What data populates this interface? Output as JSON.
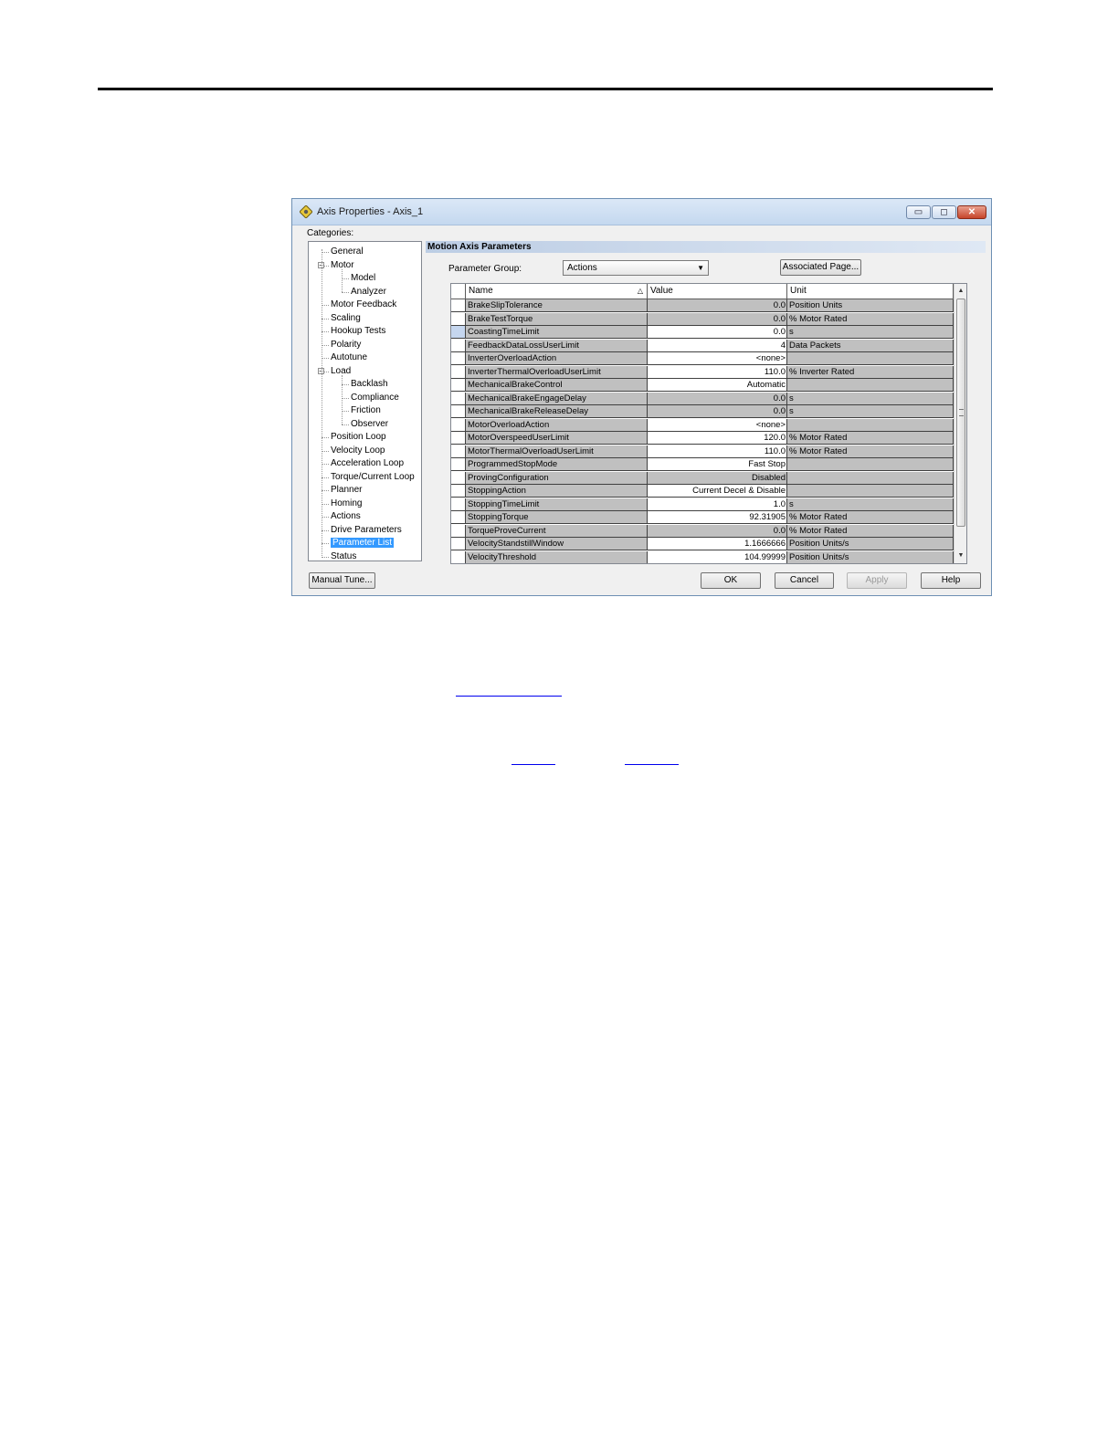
{
  "dialog": {
    "title": "Axis Properties - Axis_1",
    "controls": {
      "minimize": "▭",
      "maximize": "◻",
      "close": "✕"
    },
    "categories_label": "Categories:",
    "categories": [
      {
        "label": "General",
        "level": 1
      },
      {
        "label": "Motor",
        "level": 1,
        "expander": "−"
      },
      {
        "label": "Model",
        "level": 2
      },
      {
        "label": "Analyzer",
        "level": 2
      },
      {
        "label": "Motor Feedback",
        "level": 1
      },
      {
        "label": "Scaling",
        "level": 1
      },
      {
        "label": "Hookup Tests",
        "level": 1
      },
      {
        "label": "Polarity",
        "level": 1
      },
      {
        "label": "Autotune",
        "level": 1
      },
      {
        "label": "Load",
        "level": 1,
        "expander": "−"
      },
      {
        "label": "Backlash",
        "level": 2
      },
      {
        "label": "Compliance",
        "level": 2
      },
      {
        "label": "Friction",
        "level": 2
      },
      {
        "label": "Observer",
        "level": 2
      },
      {
        "label": "Position Loop",
        "level": 1
      },
      {
        "label": "Velocity Loop",
        "level": 1
      },
      {
        "label": "Acceleration Loop",
        "level": 1
      },
      {
        "label": "Torque/Current Loop",
        "level": 1
      },
      {
        "label": "Planner",
        "level": 1
      },
      {
        "label": "Homing",
        "level": 1
      },
      {
        "label": "Actions",
        "level": 1
      },
      {
        "label": "Drive Parameters",
        "level": 1
      },
      {
        "label": "Parameter List",
        "level": 1,
        "selected": true
      },
      {
        "label": "Status",
        "level": 1
      }
    ],
    "section_title": "Motion Axis Parameters",
    "parameter_group": {
      "label": "Parameter Group:",
      "value": "Actions"
    },
    "associated_page_label": "Associated Page...",
    "table": {
      "columns": {
        "name": "Name",
        "value": "Value",
        "unit": "Unit",
        "sort_glyph": "△"
      },
      "rows": [
        {
          "name": "BrakeSlipTolerance",
          "value": "0.0",
          "unit": "Position Units",
          "editable": false
        },
        {
          "name": "BrakeTestTorque",
          "value": "0.0",
          "unit": "% Motor Rated",
          "editable": false
        },
        {
          "name": "CoastingTimeLimit",
          "value": "0.0",
          "unit": "s",
          "editable": true,
          "active": true
        },
        {
          "name": "FeedbackDataLossUserLimit",
          "value": "4",
          "unit": "Data Packets",
          "editable": true
        },
        {
          "name": "InverterOverloadAction",
          "value": "<none>",
          "unit": "",
          "editable": true
        },
        {
          "name": "InverterThermalOverloadUserLimit",
          "value": "110.0",
          "unit": "% Inverter Rated",
          "editable": true
        },
        {
          "name": "MechanicalBrakeControl",
          "value": "Automatic",
          "unit": "",
          "editable": true
        },
        {
          "name": "MechanicalBrakeEngageDelay",
          "value": "0.0",
          "unit": "s",
          "editable": false
        },
        {
          "name": "MechanicalBrakeReleaseDelay",
          "value": "0.0",
          "unit": "s",
          "editable": false
        },
        {
          "name": "MotorOverloadAction",
          "value": "<none>",
          "unit": "",
          "editable": true
        },
        {
          "name": "MotorOverspeedUserLimit",
          "value": "120.0",
          "unit": "% Motor Rated",
          "editable": true
        },
        {
          "name": "MotorThermalOverloadUserLimit",
          "value": "110.0",
          "unit": "% Motor Rated",
          "editable": true
        },
        {
          "name": "ProgrammedStopMode",
          "value": "Fast Stop",
          "unit": "",
          "editable": true
        },
        {
          "name": "ProvingConfiguration",
          "value": "Disabled",
          "unit": "",
          "editable": false
        },
        {
          "name": "StoppingAction",
          "value": "Current Decel & Disable",
          "unit": "",
          "editable": true
        },
        {
          "name": "StoppingTimeLimit",
          "value": "1.0",
          "unit": "s",
          "editable": true
        },
        {
          "name": "StoppingTorque",
          "value": "92.31905",
          "unit": "% Motor Rated",
          "editable": true
        },
        {
          "name": "TorqueProveCurrent",
          "value": "0.0",
          "unit": "% Motor Rated",
          "editable": false
        },
        {
          "name": "VelocityStandstillWindow",
          "value": "1.1666666",
          "unit": "Position Units/s",
          "editable": true
        },
        {
          "name": "VelocityThreshold",
          "value": "104.99999",
          "unit": "Position Units/s",
          "editable": true
        }
      ]
    },
    "scroll": {
      "up": "▲",
      "down": "▼"
    },
    "buttons": {
      "manual_tune": "Manual Tune...",
      "ok": "OK",
      "cancel": "Cancel",
      "apply": "Apply",
      "help": "Help"
    }
  }
}
